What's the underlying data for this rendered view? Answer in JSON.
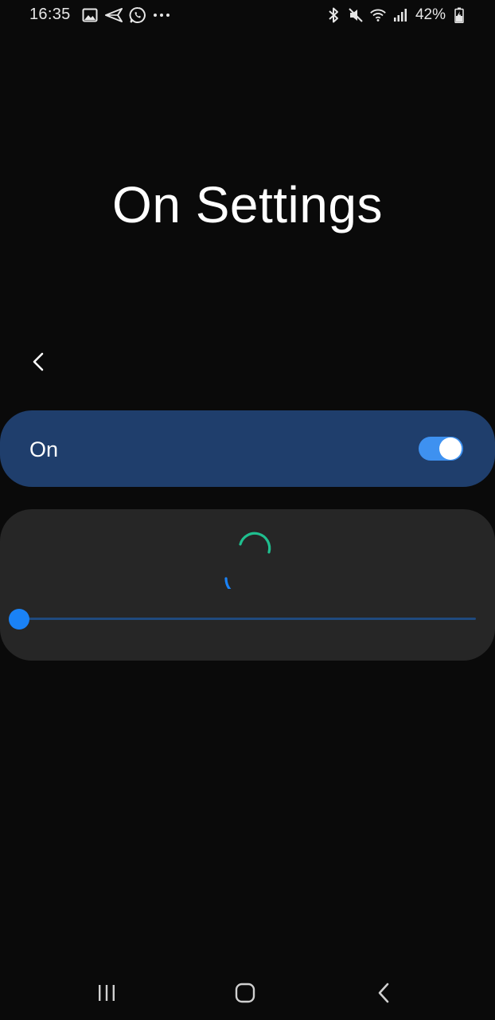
{
  "status_bar": {
    "time": "16:35",
    "left_icons": [
      "gallery-icon",
      "send-icon",
      "whatsapp-icon",
      "more-notifications-icon"
    ],
    "right_icons": [
      "bluetooth-icon",
      "mute-icon",
      "wifi-icon",
      "signal-icon"
    ],
    "battery": "42%"
  },
  "page": {
    "title": "On Settings"
  },
  "master_switch": {
    "label": "On",
    "checked": true
  },
  "slider": {
    "value": 0
  },
  "colors": {
    "background": "#0a0a0a",
    "switch_card": "#1f3e6c",
    "content_card": "#262626",
    "accent": "#3e91f0",
    "spinner_green": "#1fbf8f",
    "spinner_blue": "#1a82f5"
  },
  "nav_bar": {
    "icons": [
      "recent-apps-icon",
      "home-icon",
      "nav-back-icon"
    ]
  }
}
